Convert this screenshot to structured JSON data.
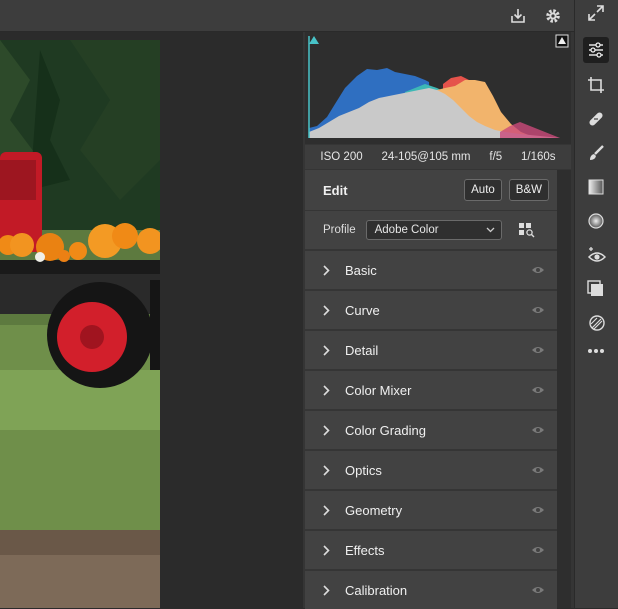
{
  "topbar": {
    "icons": [
      "download-icon",
      "gear-icon"
    ]
  },
  "exif": {
    "iso": "ISO 200",
    "lens": "24-105@105 mm",
    "aperture": "f/5",
    "shutter": "1/160s"
  },
  "edit": {
    "title": "Edit",
    "auto_label": "Auto",
    "bw_label": "B&W"
  },
  "profile": {
    "label": "Profile",
    "value": "Adobe Color"
  },
  "sections": [
    {
      "label": "Basic"
    },
    {
      "label": "Curve"
    },
    {
      "label": "Detail"
    },
    {
      "label": "Color Mixer"
    },
    {
      "label": "Color Grading"
    },
    {
      "label": "Optics"
    },
    {
      "label": "Geometry"
    },
    {
      "label": "Effects"
    },
    {
      "label": "Calibration"
    }
  ],
  "tools": [
    "edit-sliders-icon",
    "crop-icon",
    "healing-icon",
    "brush-icon",
    "linear-gradient-icon",
    "radial-gradient-icon",
    "red-eye-icon",
    "presets-icon",
    "snapshots-icon",
    "more-icon"
  ],
  "colors": {
    "accent_teal": "#48c3c8",
    "panel": "#424242",
    "truck_red": "#d21f2b",
    "pumpkin": "#f08a16"
  }
}
